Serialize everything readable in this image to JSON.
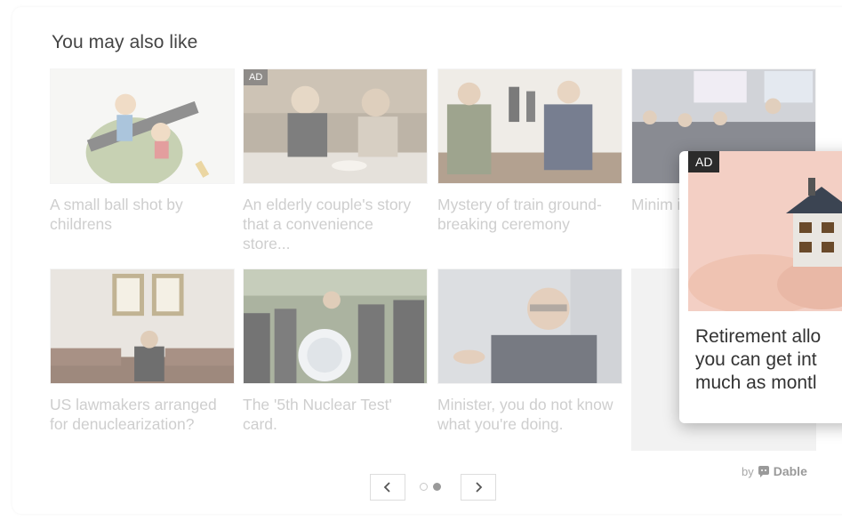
{
  "widget": {
    "title": "You may also like",
    "ad_label": "AD",
    "brand": {
      "prefix": "by",
      "name": "Dable"
    },
    "cards": [
      {
        "caption": "A small ball shot by childrens",
        "ad": false
      },
      {
        "caption": "An elderly couple's story that a convenience store...",
        "ad": true
      },
      {
        "caption": "Mystery of train ground-breaking ceremony",
        "ad": false
      },
      {
        "caption": "Minim its dec",
        "ad": false
      },
      {
        "caption": "US lawmakers arranged for denuclearization?",
        "ad": false
      },
      {
        "caption": "The '5th Nuclear Test' card.",
        "ad": false
      },
      {
        "caption": "Minister, you do not know what you're doing.",
        "ad": false
      }
    ],
    "pager": {
      "prev_icon": "chevron-left-icon",
      "next_icon": "chevron-right-icon",
      "pages": 2,
      "current": 2
    }
  },
  "popup_ad": {
    "badge": "AD",
    "text_lines": [
      "Retirement allo",
      "you can get int",
      "much as montl"
    ]
  },
  "colors": {
    "caption": "#b4b4b4",
    "title": "#444444",
    "popup_text": "#333333"
  }
}
